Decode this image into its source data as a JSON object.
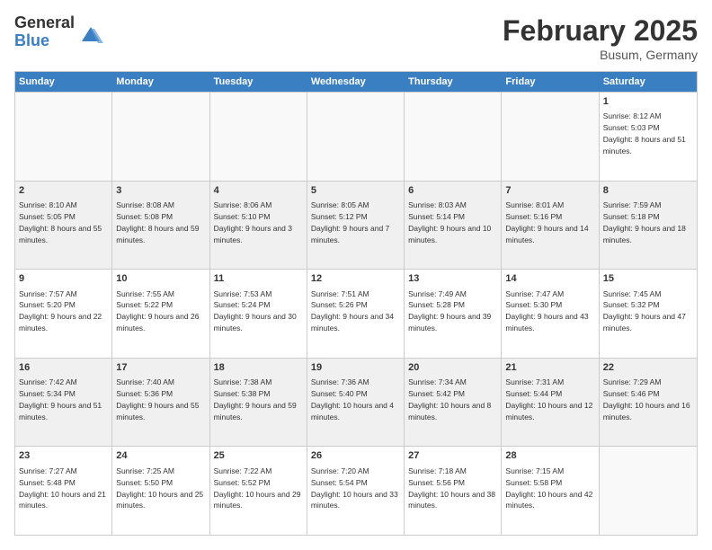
{
  "logo": {
    "general": "General",
    "blue": "Blue"
  },
  "title": "February 2025",
  "location": "Busum, Germany",
  "weekdays": [
    "Sunday",
    "Monday",
    "Tuesday",
    "Wednesday",
    "Thursday",
    "Friday",
    "Saturday"
  ],
  "rows": [
    [
      {
        "day": "",
        "text": ""
      },
      {
        "day": "",
        "text": ""
      },
      {
        "day": "",
        "text": ""
      },
      {
        "day": "",
        "text": ""
      },
      {
        "day": "",
        "text": ""
      },
      {
        "day": "",
        "text": ""
      },
      {
        "day": "1",
        "text": "Sunrise: 8:12 AM\nSunset: 5:03 PM\nDaylight: 8 hours and 51 minutes."
      }
    ],
    [
      {
        "day": "2",
        "text": "Sunrise: 8:10 AM\nSunset: 5:05 PM\nDaylight: 8 hours and 55 minutes."
      },
      {
        "day": "3",
        "text": "Sunrise: 8:08 AM\nSunset: 5:08 PM\nDaylight: 8 hours and 59 minutes."
      },
      {
        "day": "4",
        "text": "Sunrise: 8:06 AM\nSunset: 5:10 PM\nDaylight: 9 hours and 3 minutes."
      },
      {
        "day": "5",
        "text": "Sunrise: 8:05 AM\nSunset: 5:12 PM\nDaylight: 9 hours and 7 minutes."
      },
      {
        "day": "6",
        "text": "Sunrise: 8:03 AM\nSunset: 5:14 PM\nDaylight: 9 hours and 10 minutes."
      },
      {
        "day": "7",
        "text": "Sunrise: 8:01 AM\nSunset: 5:16 PM\nDaylight: 9 hours and 14 minutes."
      },
      {
        "day": "8",
        "text": "Sunrise: 7:59 AM\nSunset: 5:18 PM\nDaylight: 9 hours and 18 minutes."
      }
    ],
    [
      {
        "day": "9",
        "text": "Sunrise: 7:57 AM\nSunset: 5:20 PM\nDaylight: 9 hours and 22 minutes."
      },
      {
        "day": "10",
        "text": "Sunrise: 7:55 AM\nSunset: 5:22 PM\nDaylight: 9 hours and 26 minutes."
      },
      {
        "day": "11",
        "text": "Sunrise: 7:53 AM\nSunset: 5:24 PM\nDaylight: 9 hours and 30 minutes."
      },
      {
        "day": "12",
        "text": "Sunrise: 7:51 AM\nSunset: 5:26 PM\nDaylight: 9 hours and 34 minutes."
      },
      {
        "day": "13",
        "text": "Sunrise: 7:49 AM\nSunset: 5:28 PM\nDaylight: 9 hours and 39 minutes."
      },
      {
        "day": "14",
        "text": "Sunrise: 7:47 AM\nSunset: 5:30 PM\nDaylight: 9 hours and 43 minutes."
      },
      {
        "day": "15",
        "text": "Sunrise: 7:45 AM\nSunset: 5:32 PM\nDaylight: 9 hours and 47 minutes."
      }
    ],
    [
      {
        "day": "16",
        "text": "Sunrise: 7:42 AM\nSunset: 5:34 PM\nDaylight: 9 hours and 51 minutes."
      },
      {
        "day": "17",
        "text": "Sunrise: 7:40 AM\nSunset: 5:36 PM\nDaylight: 9 hours and 55 minutes."
      },
      {
        "day": "18",
        "text": "Sunrise: 7:38 AM\nSunset: 5:38 PM\nDaylight: 9 hours and 59 minutes."
      },
      {
        "day": "19",
        "text": "Sunrise: 7:36 AM\nSunset: 5:40 PM\nDaylight: 10 hours and 4 minutes."
      },
      {
        "day": "20",
        "text": "Sunrise: 7:34 AM\nSunset: 5:42 PM\nDaylight: 10 hours and 8 minutes."
      },
      {
        "day": "21",
        "text": "Sunrise: 7:31 AM\nSunset: 5:44 PM\nDaylight: 10 hours and 12 minutes."
      },
      {
        "day": "22",
        "text": "Sunrise: 7:29 AM\nSunset: 5:46 PM\nDaylight: 10 hours and 16 minutes."
      }
    ],
    [
      {
        "day": "23",
        "text": "Sunrise: 7:27 AM\nSunset: 5:48 PM\nDaylight: 10 hours and 21 minutes."
      },
      {
        "day": "24",
        "text": "Sunrise: 7:25 AM\nSunset: 5:50 PM\nDaylight: 10 hours and 25 minutes."
      },
      {
        "day": "25",
        "text": "Sunrise: 7:22 AM\nSunset: 5:52 PM\nDaylight: 10 hours and 29 minutes."
      },
      {
        "day": "26",
        "text": "Sunrise: 7:20 AM\nSunset: 5:54 PM\nDaylight: 10 hours and 33 minutes."
      },
      {
        "day": "27",
        "text": "Sunrise: 7:18 AM\nSunset: 5:56 PM\nDaylight: 10 hours and 38 minutes."
      },
      {
        "day": "28",
        "text": "Sunrise: 7:15 AM\nSunset: 5:58 PM\nDaylight: 10 hours and 42 minutes."
      },
      {
        "day": "",
        "text": ""
      }
    ]
  ]
}
